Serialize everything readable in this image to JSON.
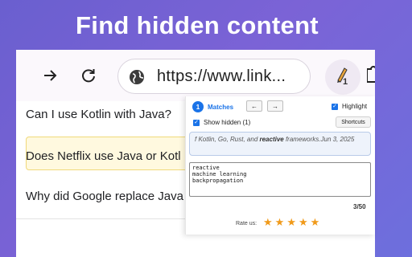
{
  "headline": "Find hidden content",
  "browser": {
    "url": "https://www.link..."
  },
  "extension": {
    "badge": "1"
  },
  "questions": [
    "Can I use Kotlin with Java?",
    "Does Netflix use Java or Kotl",
    "Why did Google replace Java"
  ],
  "popup": {
    "match_index": "1",
    "matches_label": "Matches",
    "prev_label": "←",
    "next_label": "→",
    "highlight_label": "Highlight",
    "highlight_checked": true,
    "show_hidden_label": "Show hidden (1)",
    "show_hidden_checked": true,
    "shortcuts_label": "Shortcuts",
    "snippet_before": "f Kotlin, Go, Rust, and ",
    "snippet_bold": "reactive",
    "snippet_after": " frameworks.Jun 3, 2025",
    "search_terms": [
      "reactive",
      "machine learning",
      "backpropagation"
    ],
    "page_count": "3/50",
    "rate_label": "Rate us:",
    "rating": 5
  },
  "colors": {
    "accent": "#1a73e8",
    "star": "#f09a1a",
    "highlight_bg": "#fff9df"
  }
}
